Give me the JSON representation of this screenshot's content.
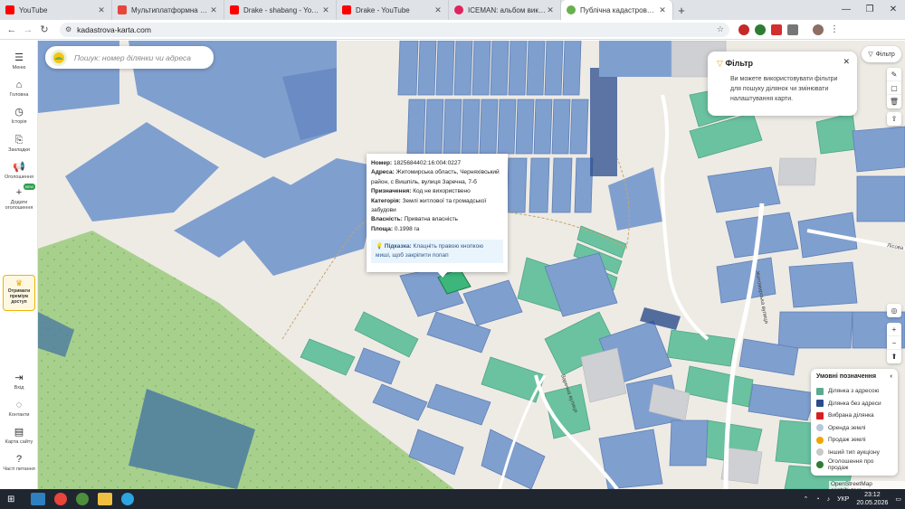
{
  "tabs": [
    {
      "label": "YouTube",
      "color": "#ff0000",
      "active": false
    },
    {
      "label": "Мультиплатформна стратегія",
      "color": "#e8453c",
      "active": false
    },
    {
      "label": "Drake - shabang - YouTube",
      "color": "#ff0000",
      "active": false
    },
    {
      "label": "Drake - YouTube",
      "color": "#ff0000",
      "active": false
    },
    {
      "label": "ICEMAN: альбом виконавця D",
      "color": "#e0245e",
      "active": false
    },
    {
      "label": "Публічна кадастрова карта Ук",
      "color": "#6ab04c",
      "active": true
    }
  ],
  "address": {
    "url": "kadastrova-karta.com"
  },
  "search": {
    "placeholder": "Пошук: номер ділянки чи адреса"
  },
  "sidebar": {
    "items": [
      {
        "label": "Меню",
        "icon": "menu-icon"
      },
      {
        "label": "Головна",
        "icon": "home-icon"
      },
      {
        "label": "Історія",
        "icon": "history-icon"
      },
      {
        "label": "Закладки",
        "icon": "bookmark-icon"
      },
      {
        "label": "Оголошення",
        "icon": "megaphone-icon"
      },
      {
        "label": "Додати оголошення",
        "icon": "plus-icon",
        "badge": "NEW"
      },
      {
        "label": "Вхід",
        "icon": "login-icon"
      },
      {
        "label": "Контакти",
        "icon": "chat-icon"
      },
      {
        "label": "Карта сайту",
        "icon": "sitemap-icon"
      },
      {
        "label": "Часті питання",
        "icon": "help-icon"
      }
    ],
    "premium": "Отримати преміум доступ"
  },
  "popup": {
    "number_label": "Номер:",
    "number": "1825684402:16:004:0227",
    "address_label": "Адреса:",
    "address": "Житомирська область, Черняхівський район, с Вишпіль, вулиця Заречна, 7-б",
    "purpose_label": "Призначення:",
    "purpose": "Код не вихориствено",
    "category_label": "Категорія:",
    "category": "Землі житлової та громадської забудови",
    "ownership_label": "Власність:",
    "ownership": "Приватна власність",
    "area_label": "Площа:",
    "area": "0.1998 га",
    "hint_label": "Підказка:",
    "hint": "Клацніть правою кнопкою миші, щоб закріпити попап"
  },
  "filter_tip": {
    "title": "Фільтр",
    "text": "Ви можете використовувати фільтри для пошуку ділянок чи змінювати налаштування карти."
  },
  "filter_button": "Фільтр",
  "legend": {
    "title": "Умовні позначення",
    "items": [
      {
        "label": "Ділянка з адресою",
        "color": "#5aaa8f"
      },
      {
        "label": "Ділянка без адреси",
        "color": "#2b4c8c"
      },
      {
        "label": "Вибрана ділянка",
        "color": "#d81f1f"
      },
      {
        "label": "Оренда землі",
        "color": "#b8c7d8"
      },
      {
        "label": "Продаж землі",
        "color": "#f0a500"
      },
      {
        "label": "Інший тип аукціону",
        "color": "#c8c8c8"
      },
      {
        "label": "Оголошення про продаж",
        "color": "#2e7d32"
      }
    ]
  },
  "map_labels": {
    "street1": "Житомирська вулиця",
    "street2": "Заречна вулиця",
    "street3": "Лісова в"
  },
  "attribution": "OpenStreetMap contributors",
  "taskbar": {
    "lang": "УКР",
    "time": "23:12",
    "date": "20.05.2026"
  }
}
